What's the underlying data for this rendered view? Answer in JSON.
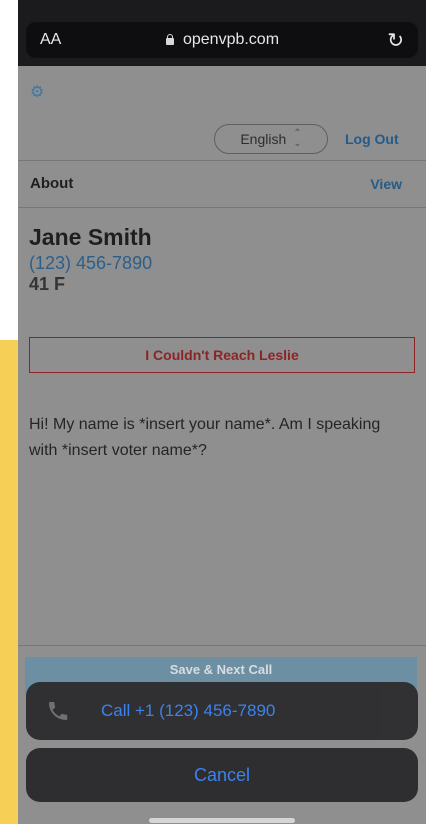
{
  "browser": {
    "text_size_label": "AA",
    "domain": "openvpb.com",
    "reload_icon": "reload-icon"
  },
  "page": {
    "settings_icon": "gear-icon",
    "language": "English",
    "logout_label": "Log Out",
    "section": {
      "title": "About",
      "view_label": "View"
    },
    "person": {
      "name": "Jane Smith",
      "phone": "(123) 456-7890",
      "demographics": "41 F"
    },
    "reach_button": "I Couldn't Reach Leslie",
    "script_text": "Hi! My name is *insert your name*. Am I speaking with *insert voter name*?",
    "save_button": "Save & Next Call"
  },
  "action_sheet": {
    "call_label": "Call +1 (123) 456-7890",
    "cancel_label": "Cancel"
  },
  "colors": {
    "link": "#245b88",
    "danger": "#8e2326",
    "ios_blue": "#3b82f0",
    "yellow_stripe": "#f6cf57"
  }
}
